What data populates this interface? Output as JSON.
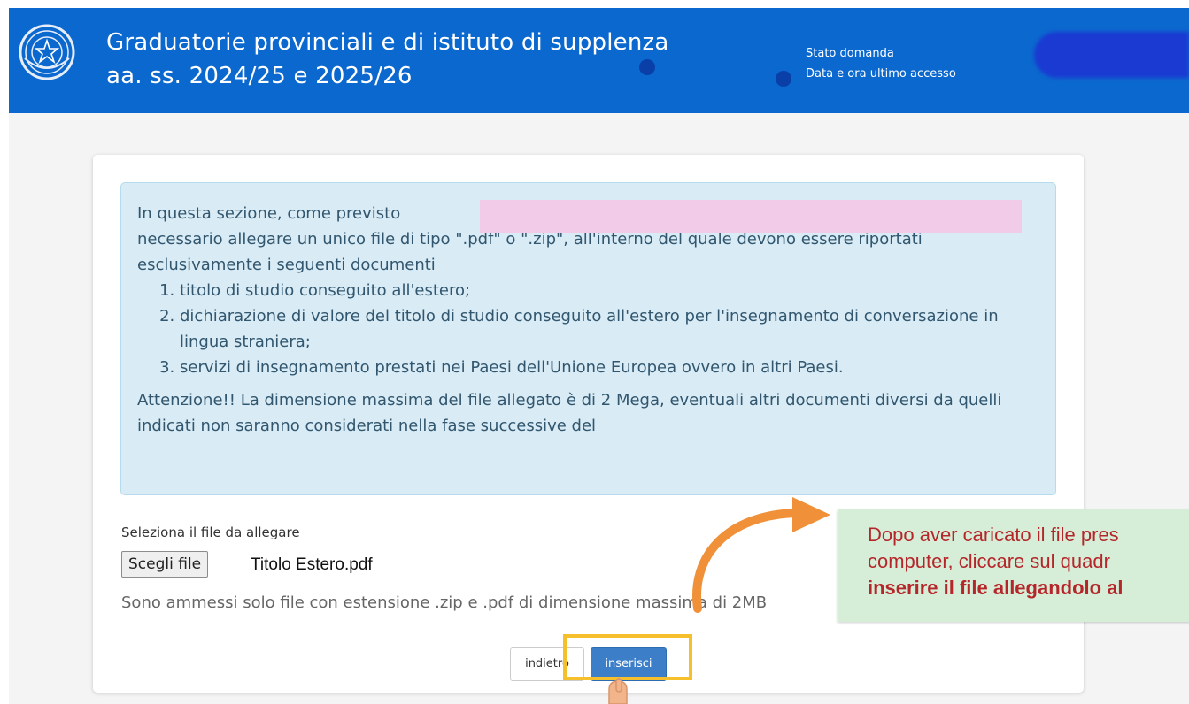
{
  "header": {
    "title_line1": "Graduatorie provinciali e di istituto di supplenza",
    "title_line2": "aa. ss. 2024/25 e 2025/26",
    "status_label": "Stato domanda",
    "last_access_label": "Data e ora ultimo accesso"
  },
  "info": {
    "intro_start": "In questa sezione, come previsto",
    "intro_rest": "necessario allegare un unico file di tipo \".pdf\" o \".zip\", all'interno del quale devono essere riportati esclusivamente i seguenti documenti",
    "items": [
      "titolo di studio conseguito all'estero;",
      "dichiarazione di valore del titolo di studio conseguito all'estero per l'insegnamento di conversazione in lingua straniera;",
      "servizi di insegnamento prestati nei Paesi dell'Unione Europea ovvero in altri Paesi."
    ],
    "attention": "Attenzione!! La dimensione massima del file allegato è di 2 Mega, eventuali altri documenti diversi da quelli indicati non saranno considerati nella fase successive del"
  },
  "upload": {
    "label": "Seleziona il file da allegare",
    "choose_button": "Scegli file",
    "file_name": "Titolo Estero.pdf",
    "help": "Sono ammessi solo file con estensione .zip e .pdf di dimensione massima di 2MB"
  },
  "actions": {
    "back_label": "indietro",
    "insert_label": "inserisci"
  },
  "tooltip": {
    "line1": "Dopo aver caricato il file pres",
    "line2": "computer, cliccare sul quadr",
    "line3": "inserire il file allegandolo al"
  },
  "colors": {
    "header_bg": "#0b68cf",
    "info_bg": "#d9ecf6",
    "primary_button": "#3d7ec9",
    "highlight": "#f6c02c",
    "annotation_arrow": "#f0913a",
    "tooltip_bg": "#d6eed7",
    "tooltip_text": "#b5262a"
  }
}
